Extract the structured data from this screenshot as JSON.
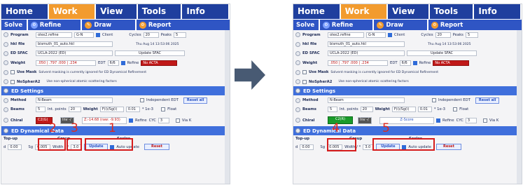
{
  "menu": [
    "Home",
    "Work",
    "View",
    "Tools",
    "Info"
  ],
  "sub": [
    "Solve",
    "Refine",
    "Draw",
    "Report"
  ],
  "program": {
    "label": "Program",
    "value": "olex2.refine",
    "option": "G-N",
    "client": "Client",
    "cycles_label": "Cycles",
    "cycles": "20",
    "peaks_label": "Peaks",
    "peaks": "5"
  },
  "hkl": {
    "label": "hkl file",
    "value": "bismuth_01_auto.hkl",
    "date": "Thu Aug 14 13:53:06 2025"
  },
  "sfac": {
    "label": "ED SFAC",
    "value": "UCLA-2022 (ED)",
    "button": "Update SFAC"
  },
  "weight": {
    "label": "Weight",
    "value": ".050 | .797   .000 | .234",
    "edt": "EDT",
    "edt_value": "6/6",
    "refine": "Refine",
    "acta": "No ACTA"
  },
  "mask": {
    "label": "Use Mask",
    "text": "Solvent masking is currently ignored for ED Dynamical Refinement"
  },
  "nospher": {
    "label": "NoSpherA2",
    "text": "Use non-spherical atomic scattering factors"
  },
  "ed": {
    "title": "ED Settings",
    "method_label": "Method",
    "method": "N-Beam",
    "indep": "Independent EDT",
    "reset": "Reset all",
    "beams_label": "Beams",
    "beams": "5",
    "int_label": "Int. points",
    "int": "20",
    "weight_label": "Weight",
    "weight_val": "F(i)/Sg(i)",
    "sg_val": "0.01",
    "exp": "* 1e-3",
    "float": "Float",
    "chiral_label": "Chiral",
    "chiral_left": "C2(G)",
    "chiral_right": "C2(R)",
    "inv": "Inv -/",
    "zscore_left": "Z:-14.68 (raw: -9.93)",
    "zscore_right": "Z-Score",
    "refine": "Refine",
    "cyc": "CYC",
    "cyc_val": "3",
    "viak": "Via K"
  },
  "dyn": {
    "title": "ED Dynamical Data",
    "topup": "Top-up",
    "group": "Group",
    "scales": "Scales",
    "d": "d",
    "d_val": "0.00",
    "sg": "Sg",
    "sg_val": "0.005",
    "width": "Width / *",
    "width_val": "3.0",
    "update": "Update",
    "auto": "Auto update",
    "reset": "Reset"
  },
  "marks": {
    "left": [
      "2",
      "3",
      "1"
    ],
    "right": [
      "4",
      "5"
    ]
  }
}
